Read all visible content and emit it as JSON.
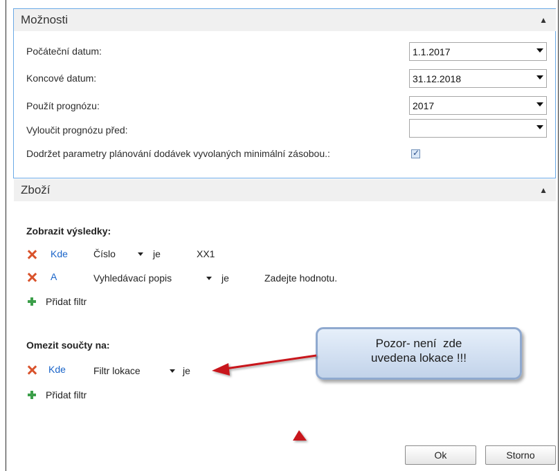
{
  "options_section": {
    "title": "Možnosti",
    "fields": [
      {
        "label": "Počáteční datum:",
        "value": "1.1.2017"
      },
      {
        "label": "Koncové datum:",
        "value": "31.12.2018"
      },
      {
        "label": "Použít prognózu:",
        "value": "2017"
      },
      {
        "label": "Vyloučit prognózu před:",
        "value": ""
      }
    ],
    "checkbox": {
      "label": "Dodržet parametry plánování dodávek vyvolaných minimální zásobou.:",
      "checked": true
    }
  },
  "items_section": {
    "title": "Zboží",
    "show_results": {
      "label": "Zobrazit výsledky:",
      "filters": [
        {
          "conj": "Kde",
          "field": "Číslo",
          "op": "je",
          "value": "XX1"
        },
        {
          "conj": "A",
          "field": "Vyhledávací popis",
          "op": "je",
          "value": "Zadejte hodnotu."
        }
      ],
      "add_filter": "Přidat filtr"
    },
    "limit_totals": {
      "label": "Omezit součty na:",
      "filters": [
        {
          "conj": "Kde",
          "field": "Filtr lokace",
          "op": "je",
          "value": ""
        }
      ],
      "add_filter": "Přidat filtr"
    }
  },
  "callout": {
    "line1": "Pozor- není  zde",
    "line2": "uvedena lokace !!!"
  },
  "buttons": {
    "ok": "Ok",
    "cancel": "Storno"
  },
  "colors": {
    "accent": "#6aa9e6",
    "link": "#1a64c9",
    "remove": "#d9532c",
    "add": "#3c9f4a",
    "arrow": "#c8141a"
  },
  "icons": [
    "close-icon",
    "plus-icon",
    "chevron-up-icon",
    "dropdown-arrow-icon",
    "check-icon"
  ]
}
